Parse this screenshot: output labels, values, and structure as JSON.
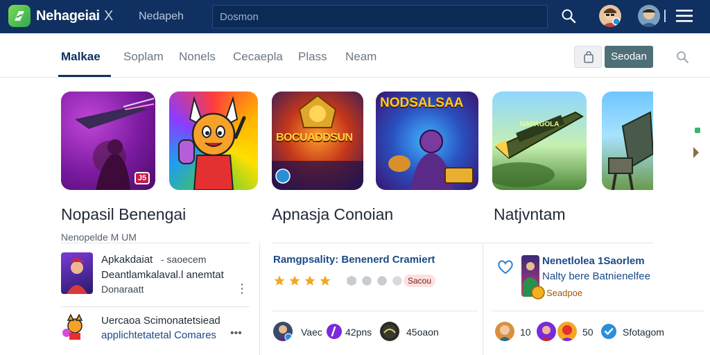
{
  "app": {
    "brand": "Nehageiai",
    "brand_close": "X",
    "top_tab": "Nedapeh",
    "search_placeholder": "Dosmon"
  },
  "subnav": {
    "tabs": [
      "Malkae",
      "Soplam",
      "Nonels",
      "Cecaepla",
      "Plass",
      "Neam"
    ],
    "primary_button": "Seodan"
  },
  "featured": {
    "tiles": [
      {
        "name": "space-shooter",
        "text": ""
      },
      {
        "name": "cartoon-hero",
        "text": ""
      },
      {
        "name": "gold-emblem",
        "text": "BOCUADDSUN"
      },
      {
        "name": "arena-brawler",
        "text": "NODSALSAA"
      },
      {
        "name": "jet-fighter",
        "text": "NAPAGOLA"
      },
      {
        "name": "mech-warrior",
        "text": ""
      }
    ],
    "tile1_badge": "J5"
  },
  "sections": {
    "left_title": "Nopasil Benengai",
    "left_subtitle": "Nenopelde M UM",
    "mid_title": "Apnasja Conoian",
    "right_title": "Natjvntam"
  },
  "left_list": [
    {
      "title": "Apkakdaiat",
      "meta": "- saoecem",
      "line2": "Deantlamkalaval.l anemtat",
      "line3": "Donaraatt"
    },
    {
      "title": "Uercaoa Scimonatetsiead",
      "line2": "applichtetatetal Comares"
    }
  ],
  "mid_card": {
    "headline": "Ramgpsality: Benenerd Cramiert",
    "rating": 4,
    "pill": "Sacou",
    "stats": [
      {
        "value": "Vaec"
      },
      {
        "value": "42pns"
      },
      {
        "value": "45oaon"
      }
    ]
  },
  "right_card": {
    "title": "Nenetlolea 1Saorlem",
    "line2": "Nalty bere Batnienelfee",
    "tag": "Seadpoe",
    "stats": [
      {
        "value": "10"
      },
      {
        "value": "50"
      },
      {
        "value": "Sfotagom"
      }
    ]
  },
  "colors": {
    "topbar": "#0f3060",
    "accent": "#0f3060",
    "primary_button": "#4e6f78",
    "star": "#f5a623"
  }
}
